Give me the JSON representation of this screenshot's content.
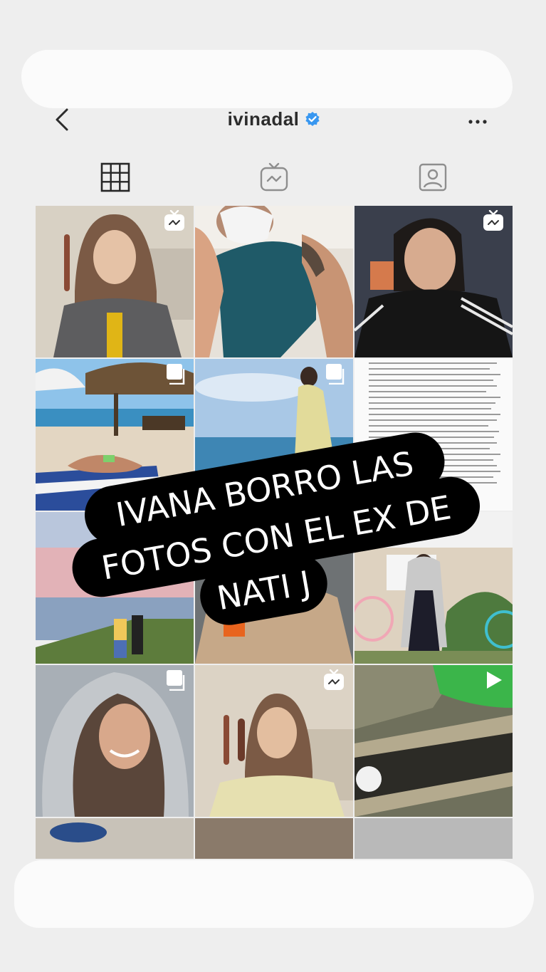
{
  "profile": {
    "username": "ivinadal",
    "verified": true
  },
  "tabs": [
    {
      "icon": "grid-icon"
    },
    {
      "icon": "igtv-icon"
    },
    {
      "icon": "tagged-icon"
    }
  ],
  "grid": {
    "badges": [
      "igtv-icon",
      "",
      "igtv-icon",
      "carousel-icon",
      "carousel-icon",
      "",
      "",
      "",
      "",
      "carousel-icon",
      "igtv-icon",
      "play-icon"
    ]
  },
  "overlay": {
    "lines": [
      "IVANA BORRO LAS",
      "FOTOS CON EL EX DE",
      "NATI J"
    ]
  }
}
